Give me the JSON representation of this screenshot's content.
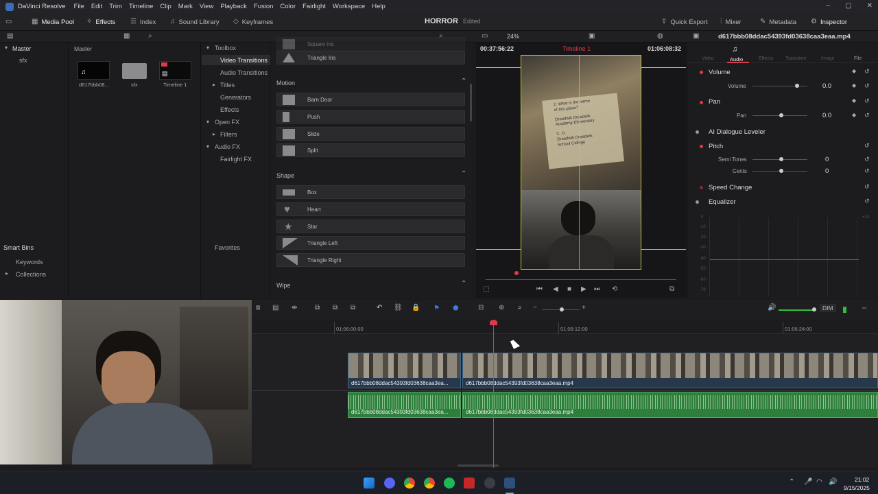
{
  "menubar": {
    "app": "DaVinci Resolve",
    "items": [
      "File",
      "Edit",
      "Trim",
      "Timeline",
      "Clip",
      "Mark",
      "View",
      "Playback",
      "Fusion",
      "Color",
      "Fairlight",
      "Workspace",
      "Help"
    ]
  },
  "toolbar": {
    "media_pool": "Media Pool",
    "effects": "Effects",
    "index": "Index",
    "sound_library": "Sound Library",
    "keyframes": "Keyframes",
    "project": "HORROR",
    "project_status": "Edited",
    "quick_export": "Quick Export",
    "mixer": "Mixer",
    "metadata": "Metadata",
    "inspector": "Inspector"
  },
  "panelbar": {
    "effects_zoom": "24%",
    "timecode_left": "00:37:56:22",
    "timeline_name": "Timeline 1",
    "timecode_right": "01:06:08:32",
    "inspector_clip": "d617bbb08ddac54393fd03638caa3eaa.mp4"
  },
  "mediapool": {
    "master": "Master",
    "folder_sfx": "sfx",
    "header": "Master",
    "clips": [
      {
        "name": "d617bbb08..."
      },
      {
        "name": "sfx"
      },
      {
        "name": "Timeline 1"
      }
    ],
    "smart_bins": "Smart Bins",
    "keywords": "Keywords",
    "collections": "Collections"
  },
  "effects_tree": {
    "toolbox": "Toolbox",
    "video_transitions": "Video Transitions",
    "audio_transitions": "Audio Transitions",
    "titles": "Titles",
    "generators": "Generators",
    "effects": "Effects",
    "open_fx": "Open FX",
    "filters": "Filters",
    "audio_fx": "Audio FX",
    "fairlight_fx": "Fairlight FX",
    "favorites": "Favorites"
  },
  "effects_list": {
    "partial_top": "Square Iris",
    "triangle_iris": "Triangle Iris",
    "motion": "Motion",
    "barn_door": "Barn Door",
    "push": "Push",
    "slide": "Slide",
    "split": "Split",
    "shape": "Shape",
    "box": "Box",
    "heart": "Heart",
    "star": "Star",
    "triangle_left": "Triangle Left",
    "triangle_right": "Triangle Right",
    "wipe": "Wipe"
  },
  "inspector": {
    "tabs": [
      "Video",
      "Audio",
      "Effects",
      "Transition",
      "Image",
      "File"
    ],
    "active_tab": "Audio",
    "volume": "Volume",
    "volume_label": "Volume",
    "volume_val": "0.0",
    "pan": "Pan",
    "pan_label": "Pan",
    "pan_val": "0.0",
    "ai_dialogue": "AI Dialogue Leveler",
    "pitch": "Pitch",
    "semi_tones": "Semi Tones",
    "semi_val": "0",
    "cents": "Cents",
    "cents_val": "0",
    "speed_change": "Speed Change",
    "equalizer": "Equalizer",
    "eq_scale": [
      "+24",
      "0",
      "-10",
      "-20",
      "-30",
      "-40",
      "-50",
      "-60",
      "-70",
      "-80",
      "-90"
    ]
  },
  "viewer": {
    "frame_text": [
      "2. What is the name",
      "of this place?",
      "Dreadwik",
      "Academy",
      "Dreadwik",
      "Elementary",
      "C.",
      "Dreadwik",
      "School",
      "D.",
      "Dreadwik",
      "College"
    ]
  },
  "timeline": {
    "dim": "DIM",
    "ruler": [
      "01:06:00:00",
      "01:06:12:00",
      "01:06:24:00"
    ],
    "clip_name": "d617bbb08ddac54393fd03638caa3eaa.mp4",
    "clip_short": "d617bbb08ddac54393fd03638caa3ea..."
  },
  "taskbar": {
    "time": "21:02",
    "date": "9/15/2025"
  }
}
